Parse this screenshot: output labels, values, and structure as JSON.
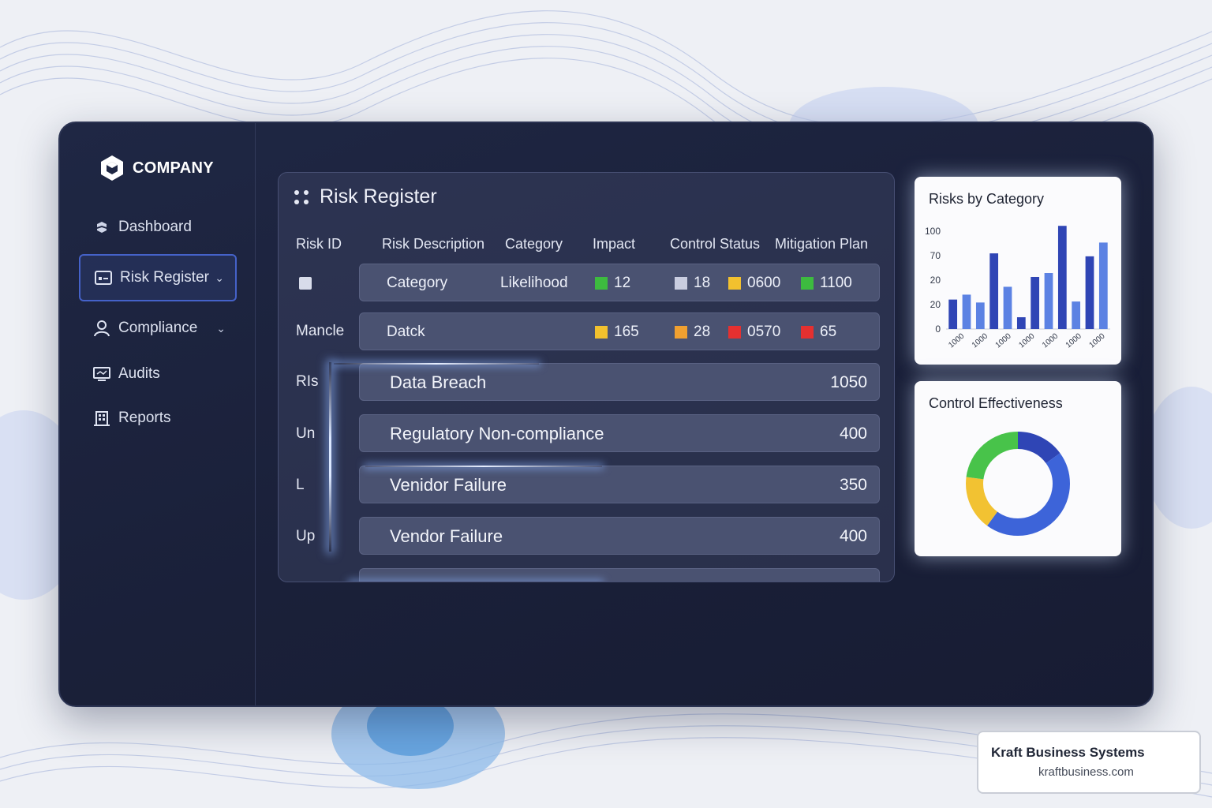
{
  "brand": {
    "name": "COMPANY"
  },
  "sidebar": {
    "items": [
      {
        "label": "Dashboard",
        "icon": "gear-icon",
        "active": false,
        "has_chevron": false
      },
      {
        "label": "Risk Register",
        "icon": "register-icon",
        "active": true,
        "has_chevron": true
      },
      {
        "label": "Compliance",
        "icon": "user-icon",
        "active": false,
        "has_chevron": true
      },
      {
        "label": "Audits",
        "icon": "monitor-icon",
        "active": false,
        "has_chevron": false
      },
      {
        "label": "Reports",
        "icon": "building-icon",
        "active": false,
        "has_chevron": false
      }
    ]
  },
  "register": {
    "title": "Risk Register",
    "columns": [
      "Risk ID",
      "Risk Description",
      "Category",
      "Impact",
      "Control Status",
      "Mitigation Plan"
    ],
    "row_labels": [
      "Mancle",
      "RIs",
      "Un",
      "L",
      "Up"
    ],
    "detail_rows": [
      {
        "description": "Category",
        "category": "Likelihood",
        "impact": {
          "value": "12",
          "color": "#3dbb3f"
        },
        "control": {
          "value": "18",
          "color": "#c9cde0"
        },
        "mitigation_a": {
          "value": "0600",
          "color": "#f2c12e"
        },
        "mitigation_b": {
          "value": "1100",
          "color": "#3dbb3f"
        }
      },
      {
        "description": "Datck",
        "category": "",
        "impact": {
          "value": "165",
          "color": "#f2c12e"
        },
        "control": {
          "value": "28",
          "color": "#f0a030"
        },
        "mitigation_a": {
          "value": "0570",
          "color": "#e53030"
        },
        "mitigation_b": {
          "value": "65",
          "color": "#e53030"
        }
      }
    ],
    "risks": [
      {
        "name": "Data Breach",
        "value": "1050"
      },
      {
        "name": "Regulatory Non-compliance",
        "value": "400"
      },
      {
        "name": "Venidor Failure",
        "value": "350"
      },
      {
        "name": "Vendor Failure",
        "value": "400"
      }
    ]
  },
  "chart_data": [
    {
      "type": "bar",
      "title": "Risks by Category",
      "y_ticks": [
        "100",
        "70",
        "20",
        "20",
        "0"
      ],
      "x_ticks": [
        "1000",
        "1000",
        "1000",
        "1000",
        "1000",
        "1000",
        "1000"
      ],
      "series_colors": [
        "#2f45b5",
        "#5c82e3"
      ],
      "values": [
        30,
        35,
        27,
        77,
        43,
        12,
        53,
        57,
        105,
        28,
        74,
        88
      ],
      "bar_colors": [
        "dark",
        "light",
        "light",
        "dark",
        "light",
        "dark",
        "dark",
        "light",
        "dark",
        "light",
        "dark",
        "light"
      ],
      "ylim": [
        0,
        110
      ]
    },
    {
      "type": "pie",
      "title": "Control Effectiveness",
      "donut": true,
      "slices": [
        {
          "value": 15,
          "color": "#2f45b5"
        },
        {
          "value": 45,
          "color": "#3d64d9"
        },
        {
          "value": 17,
          "color": "#f2c232"
        },
        {
          "value": 23,
          "color": "#48c34a"
        }
      ]
    }
  ],
  "footer_badge": {
    "title": "Kraft Business Systems",
    "url": "kraftbusiness.com"
  }
}
